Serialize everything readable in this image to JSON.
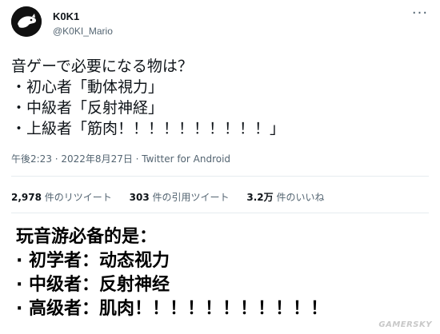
{
  "tweet": {
    "display_name": "K0K1",
    "handle": "@K0KI_Mario",
    "text_lines": [
      "音ゲーで必要になる物は？",
      "・初心者「動体視力」",
      "・中級者「反射神経」",
      "・上級者「筋肉！！！！！！！！！！」"
    ],
    "timestamp": "午後2:23 · 2022年8月27日 ·",
    "source": "Twitter for Android",
    "stats": [
      {
        "count": "2,978",
        "label": "件のリツイート"
      },
      {
        "count": "303",
        "label": "件の引用ツイート"
      },
      {
        "count": "3.2万",
        "label": "件のいいね"
      }
    ]
  },
  "caption": {
    "lines": [
      "玩音游必备的是：",
      "· 初学者：动态视力",
      "· 中级者：反射神经",
      "· 高级者：肌肉！！！！！！！！！！！"
    ]
  },
  "watermark": "GAMERSKY"
}
